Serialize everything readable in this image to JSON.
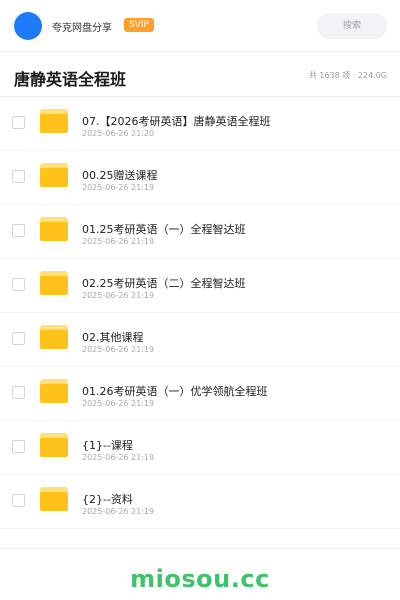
{
  "header": {
    "app_name": "夸克网盘分享",
    "badge": "SVIP",
    "search_placeholder": "搜索",
    "avatar_color": "#1e7bf7",
    "badge_color": "#ffa02a"
  },
  "title_bar": {
    "title": "唐静英语全程班",
    "summary": "共 1638 项 · 224.0G"
  },
  "files": [
    {
      "name": "07.【2026考研英语】唐静英语全程班",
      "date": "2025-06-26 21:20",
      "icon": "folder-icon"
    },
    {
      "name": "00.25赠送课程",
      "date": "2025-06-26 21:19",
      "icon": "folder-icon"
    },
    {
      "name": "01.25考研英语（一）全程智达班",
      "date": "2025-06-26 21:19",
      "icon": "folder-icon"
    },
    {
      "name": "02.25考研英语（二）全程智达班",
      "date": "2025-06-26 21:19",
      "icon": "folder-icon"
    },
    {
      "name": "02.其他课程",
      "date": "2025-06-26 21:19",
      "icon": "folder-icon"
    },
    {
      "name": "01.26考研英语（一）优学领航全程班",
      "date": "2025-06-26 21:19",
      "icon": "folder-icon"
    },
    {
      "name": "{1}--课程",
      "date": "2025-06-26 21:19",
      "icon": "folder-icon"
    },
    {
      "name": "{2}--资料",
      "date": "2025-06-26 21:19",
      "icon": "folder-icon"
    }
  ],
  "footer": {
    "brand": "miosou.cc",
    "brand_color": "#3ec36a"
  }
}
